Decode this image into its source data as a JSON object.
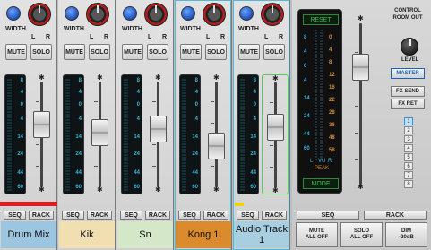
{
  "colors": {
    "channel_label_drum_mix": "#9cc6e0",
    "channel_label_kik": "#f1dfb2",
    "channel_label_sn": "#d4e7c8",
    "channel_label_kong": "#db8a2c",
    "channel_label_audio": "#a8cfe0",
    "record_bar": "#dc1e1e",
    "meter_scale": "#36b6d4",
    "vu_right_scale": "#d98a2c",
    "vu_button": "#3fc24e"
  },
  "channel_controls": {
    "width_label": "WIDTH",
    "left_label": "L",
    "right_label": "R",
    "mute_label": "MUTE",
    "solo_label": "SOLO",
    "seq_label": "SEQ",
    "rack_label": "RACK",
    "meter_scale": [
      "8",
      "4",
      "0",
      "4",
      "14",
      "24",
      "44",
      "60"
    ]
  },
  "channels": [
    {
      "name": "Drum Mix",
      "fader_level": 0.62
    },
    {
      "name": "Kik",
      "fader_level": 0.52
    },
    {
      "name": "Sn",
      "fader_level": 0.57
    },
    {
      "name": "Kong 1",
      "fader_level": 0.35
    },
    {
      "name": "Audio Track 1",
      "fader_level": 0.6
    }
  ],
  "master": {
    "reset_label": "RESET",
    "mode_label": "MODE",
    "vu_left_scale": [
      "8",
      "4",
      "0",
      "4",
      "14",
      "24",
      "44",
      "60"
    ],
    "vu_right_scale": [
      "0",
      "4",
      "8",
      "12",
      "16",
      "22",
      "28",
      "36",
      "48",
      "58"
    ],
    "vu_label": "VU",
    "peak_label": "PEAK",
    "left_label": "L",
    "right_label": "R",
    "control_room_out": "CONTROL ROOM OUT",
    "level_label": "LEVEL",
    "master_label": "MASTER",
    "fx_send_label": "FX SEND",
    "fx_ret_label": "FX RET",
    "numbers": [
      "1",
      "2",
      "3",
      "4",
      "5",
      "6",
      "7",
      "8"
    ],
    "selected_number": "1",
    "seq_label": "SEQ",
    "rack_label": "RACK",
    "mute_all": "MUTE\nALL OFF",
    "solo_all": "SOLO\nALL OFF",
    "dim": "DIM\n-20dB"
  }
}
